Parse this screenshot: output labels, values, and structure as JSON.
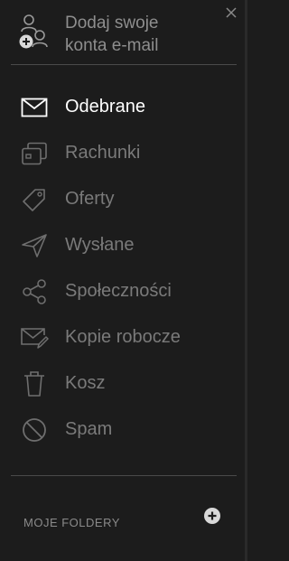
{
  "sidebar": {
    "add_account_label": "Dodaj swoje konta e-mail",
    "items": [
      {
        "label": "Odebrane",
        "icon": "inbox-envelope-icon",
        "active": true
      },
      {
        "label": "Rachunki",
        "icon": "bills-icon",
        "active": false
      },
      {
        "label": "Oferty",
        "icon": "tag-icon",
        "active": false
      },
      {
        "label": "Wysłane",
        "icon": "send-plane-icon",
        "active": false
      },
      {
        "label": "Społeczności",
        "icon": "share-icon",
        "active": false
      },
      {
        "label": "Kopie robocze",
        "icon": "draft-icon",
        "active": false
      },
      {
        "label": "Kosz",
        "icon": "trash-icon",
        "active": false
      },
      {
        "label": "Spam",
        "icon": "spam-icon",
        "active": false
      }
    ],
    "folders_title": "MOJE FOLDERY"
  },
  "colors": {
    "background": "#1c1c1c",
    "active_text": "#ffffff",
    "inactive_text": "#7a7a7a",
    "divider": "#4a4a4a"
  }
}
